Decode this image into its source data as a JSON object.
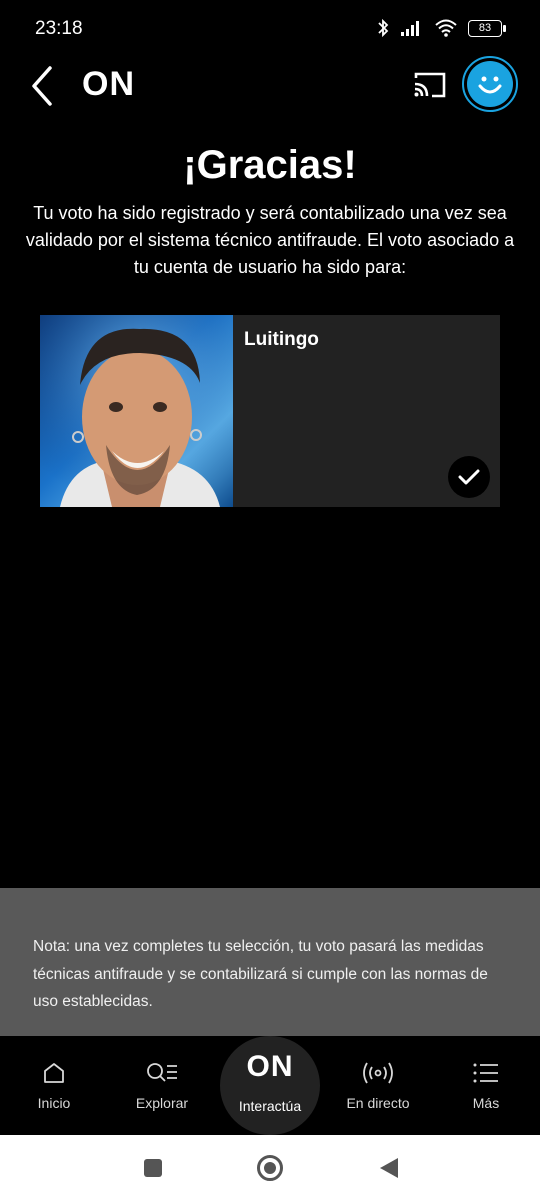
{
  "status_bar": {
    "time": "23:18",
    "battery": "83",
    "icons": [
      "bluetooth-icon",
      "signal-icon",
      "wifi-icon",
      "battery-icon"
    ]
  },
  "header": {
    "title": "ON",
    "icons": [
      "back-arrow-icon",
      "cast-icon",
      "smiley-avatar-icon"
    ],
    "accent_color": "#1aa3e0"
  },
  "main": {
    "title": "¡Gracias!",
    "message": "Tu voto ha sido registrado y será contabilizado una vez sea validado por el sistema técnico antifraude. El voto asociado a tu cuenta de usuario ha sido para:",
    "selection": {
      "name": "Luitingo",
      "selected": true
    }
  },
  "note": {
    "text": "Nota: una vez completes tu selección, tu voto pasará las medidas técnicas antifraude y se contabilizará si cumple con las normas de uso establecidas."
  },
  "bottom_nav": {
    "items": [
      {
        "label": "Inicio",
        "icon": "home-icon"
      },
      {
        "label": "Explorar",
        "icon": "search-list-icon"
      },
      {
        "label": "Interactúa",
        "icon": "on-power-logo",
        "logo_text": "ON",
        "active": true
      },
      {
        "label": "En directo",
        "icon": "broadcast-icon"
      },
      {
        "label": "Más",
        "icon": "menu-icon"
      }
    ]
  },
  "system_nav": {
    "icons": [
      "recents-square-icon",
      "home-circle-icon",
      "back-triangle-icon"
    ]
  }
}
